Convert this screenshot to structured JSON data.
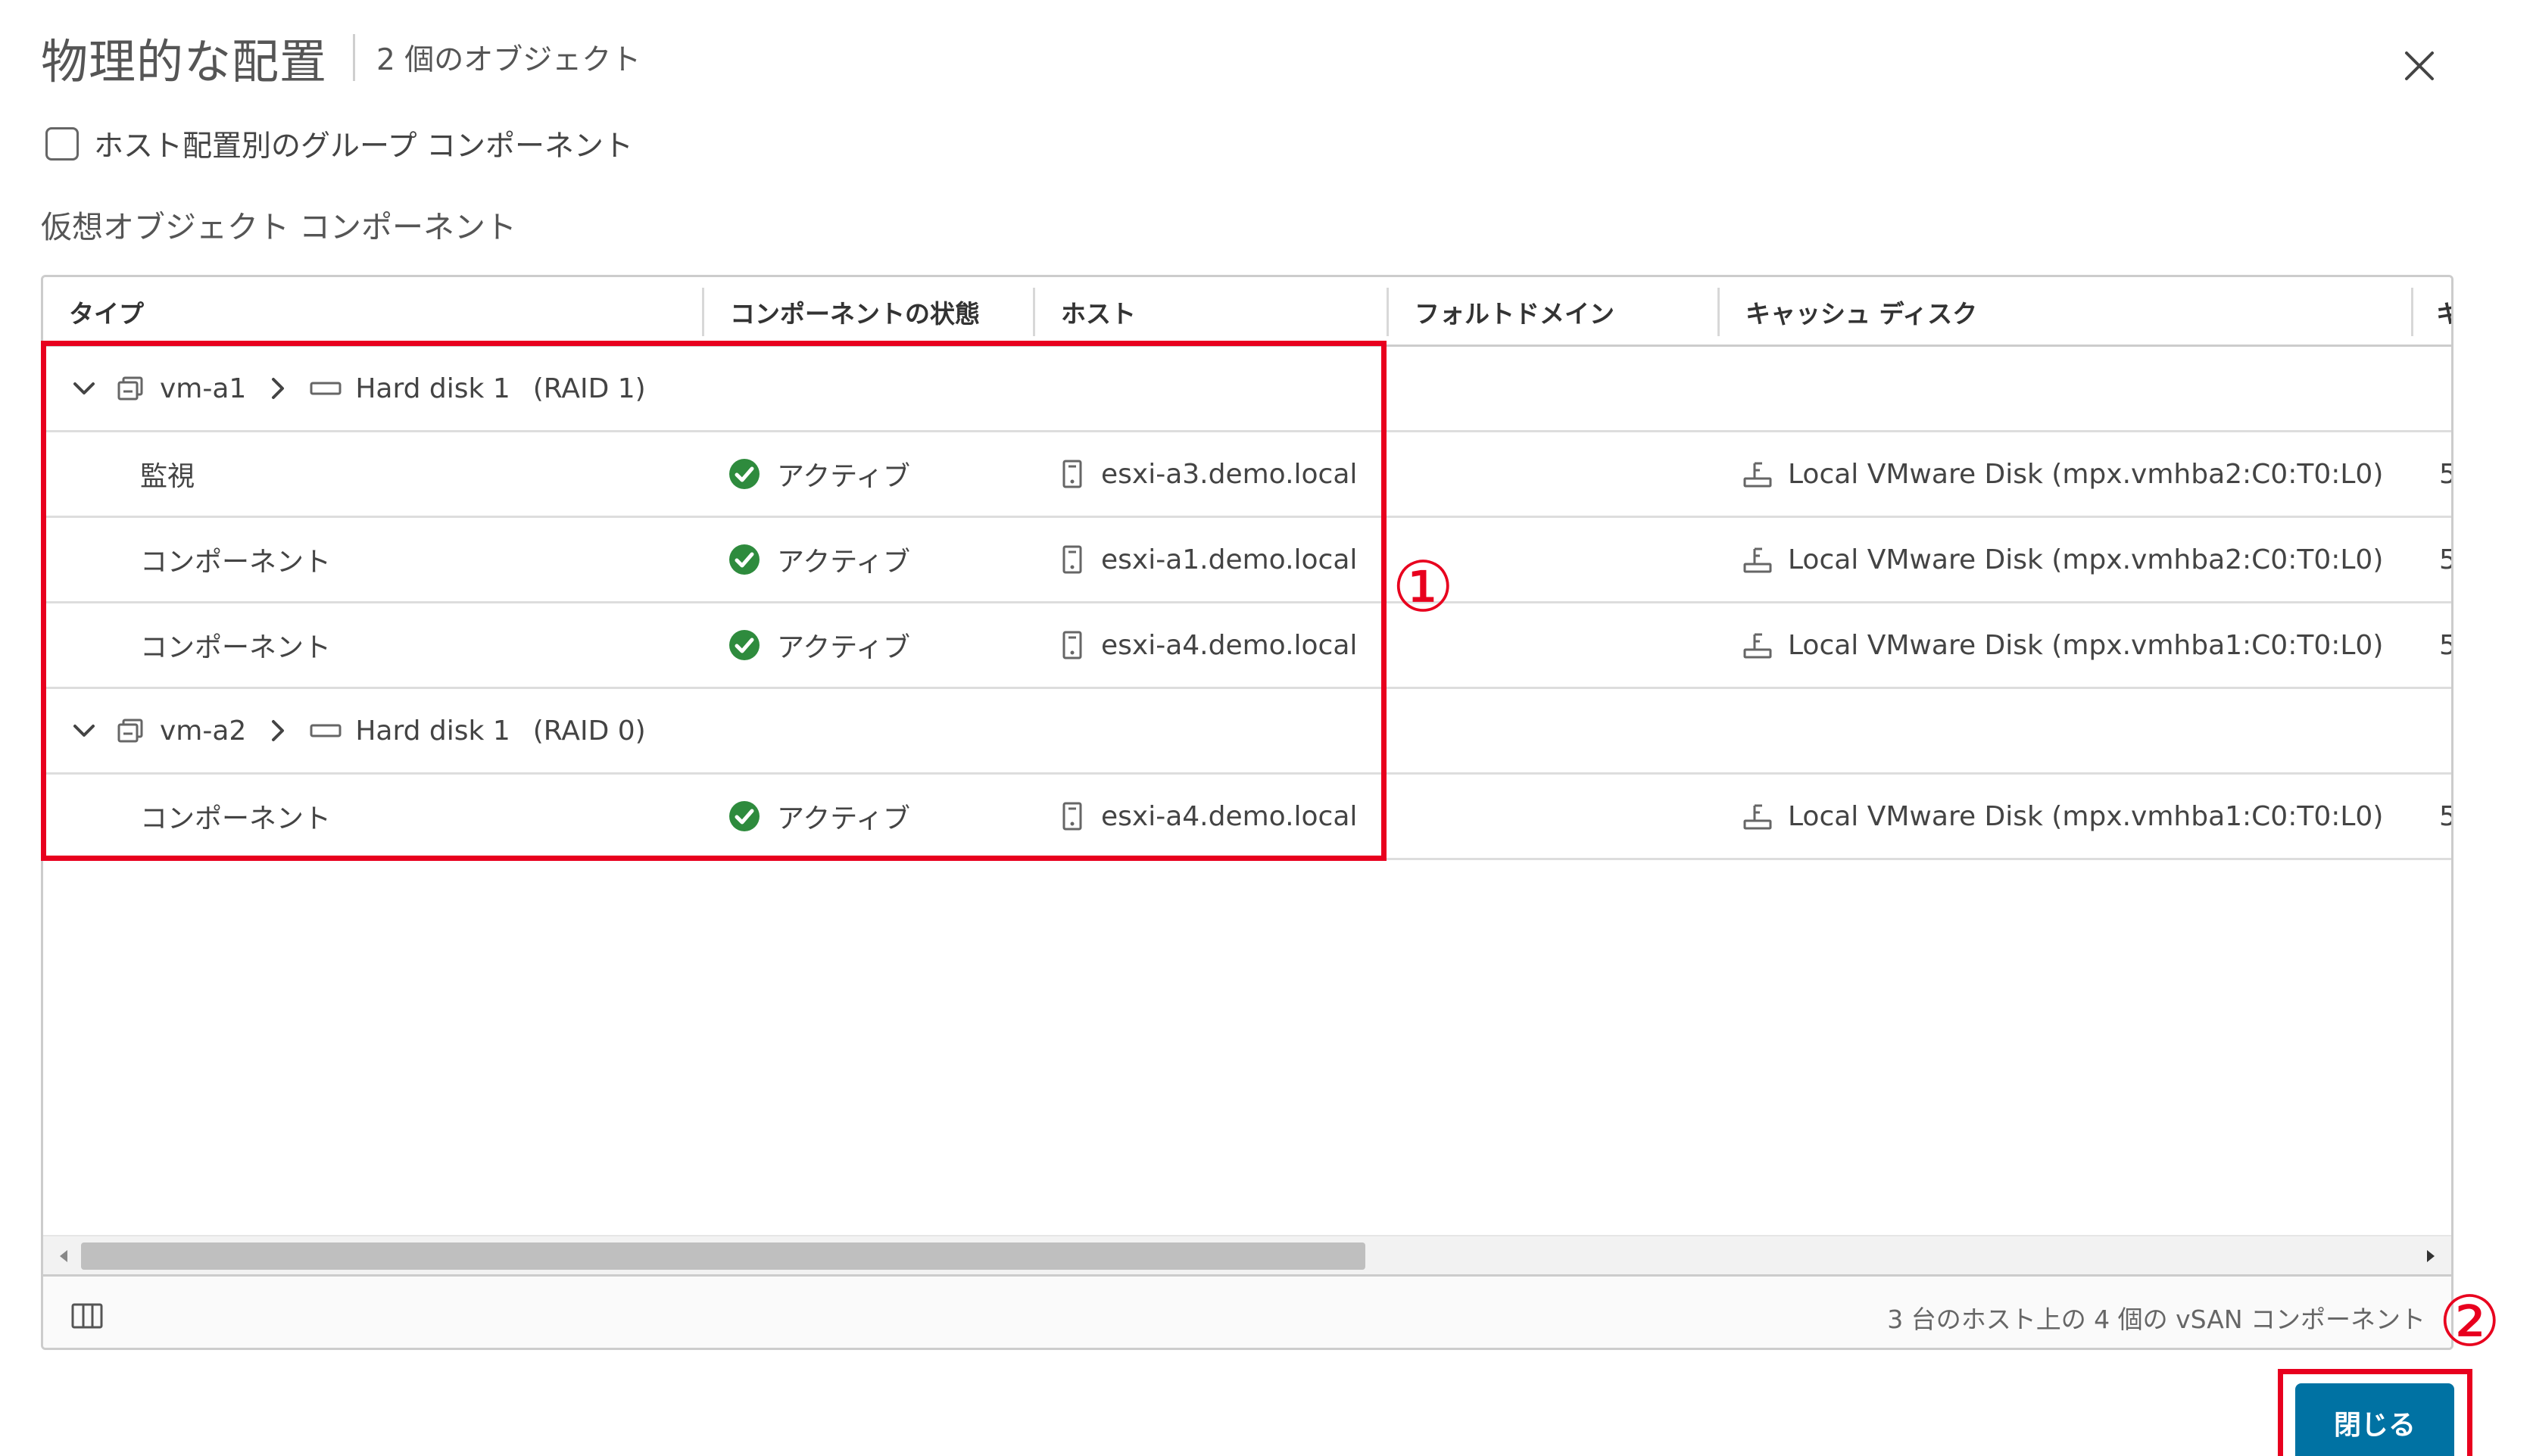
{
  "dialog": {
    "title": "物理的な配置",
    "subtitle": "2 個のオブジェクト"
  },
  "group_option": {
    "label": "ホスト配置別のグループ コンポーネント",
    "checked": false
  },
  "section_label": "仮想オブジェクト コンポーネント",
  "grid": {
    "columns": [
      {
        "label": "タイプ"
      },
      {
        "label": "コンポーネントの状態"
      },
      {
        "label": "ホスト"
      },
      {
        "label": "フォルトドメイン"
      },
      {
        "label": "キャッシュ ディスク"
      },
      {
        "label": "キ"
      }
    ],
    "groups": [
      {
        "vm": "vm-a1",
        "disk": "Hard disk 1",
        "raid": "(RAID 1)",
        "rows": [
          {
            "type": "監視",
            "state": "アクティブ",
            "host": "esxi-a3.demo.local",
            "fault_domain": "",
            "cache_disk": "Local VMware Disk (mpx.vmhba2:C0:T0:L0)",
            "extra": "5"
          },
          {
            "type": "コンポーネント",
            "state": "アクティブ",
            "host": "esxi-a1.demo.local",
            "fault_domain": "",
            "cache_disk": "Local VMware Disk (mpx.vmhba2:C0:T0:L0)",
            "extra": "5"
          },
          {
            "type": "コンポーネント",
            "state": "アクティブ",
            "host": "esxi-a4.demo.local",
            "fault_domain": "",
            "cache_disk": "Local VMware Disk (mpx.vmhba1:C0:T0:L0)",
            "extra": "5"
          }
        ]
      },
      {
        "vm": "vm-a2",
        "disk": "Hard disk 1",
        "raid": "(RAID 0)",
        "rows": [
          {
            "type": "コンポーネント",
            "state": "アクティブ",
            "host": "esxi-a4.demo.local",
            "fault_domain": "",
            "cache_disk": "Local VMware Disk (mpx.vmhba1:C0:T0:L0)",
            "extra": "5"
          }
        ]
      }
    ],
    "footer_summary": "3 台のホスト上の 4 個の vSAN コンポーネント"
  },
  "buttons": {
    "close_label": "閉じる"
  },
  "annotations": {
    "marker_1": "①",
    "marker_2": "②",
    "color": "#e8001e"
  },
  "colors": {
    "primary_button": "#0072a3",
    "status_ok": "#2e8b3d",
    "highlight": "#e8001e"
  },
  "icons": {
    "close": "close-icon",
    "expand": "chevron-down-icon",
    "vm": "vm-icon",
    "disk": "disk-icon",
    "host": "host-icon",
    "status": "check-circle-icon",
    "cache": "cache-disk-icon",
    "columns": "column-toggle-icon"
  }
}
